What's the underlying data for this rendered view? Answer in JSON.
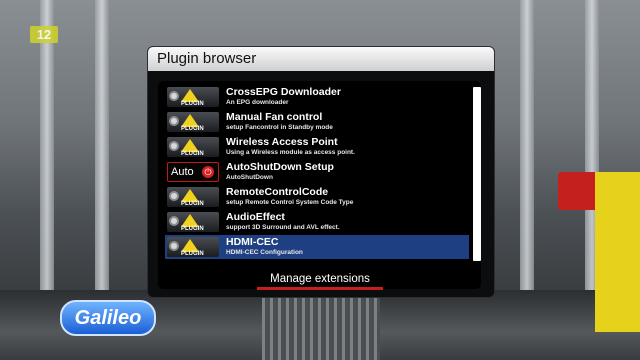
{
  "channel_logo": "12",
  "show_logo": "Galileo",
  "window": {
    "title": "Plugin browser"
  },
  "plugins": [
    {
      "name": "CrossEPG Downloader",
      "description": "An EPG downloader",
      "icon": "plugin-icon",
      "thumb_label": "PLUGIN"
    },
    {
      "name": "Manual Fan control",
      "description": "setup Fancontrol in Standby mode",
      "icon": "plugin-icon",
      "thumb_label": "PLUGIN"
    },
    {
      "name": "Wireless Access Point",
      "description": "Using a Wireless module as access point.",
      "icon": "plugin-icon",
      "thumb_label": "PLUGIN"
    },
    {
      "name": "AutoShutDown Setup",
      "description": "AutoShutDown",
      "icon": "auto-power-icon",
      "thumb_label": "Auto"
    },
    {
      "name": "RemoteControlCode",
      "description": "setup Remote Control System Code Type",
      "icon": "plugin-icon",
      "thumb_label": "PLUGIN"
    },
    {
      "name": "AudioEffect",
      "description": "support 3D Surround and AVL effect.",
      "icon": "plugin-icon",
      "thumb_label": "PLUGIN"
    },
    {
      "name": "HDMI-CEC",
      "description": "HDMI-CEC Configuration",
      "icon": "plugin-icon",
      "thumb_label": "PLUGIN"
    }
  ],
  "selected_index": 6,
  "manage_button": {
    "label": "Manage extensions"
  },
  "colors": {
    "selection": "#1f3f83",
    "button_underline": "#c61d1d"
  }
}
